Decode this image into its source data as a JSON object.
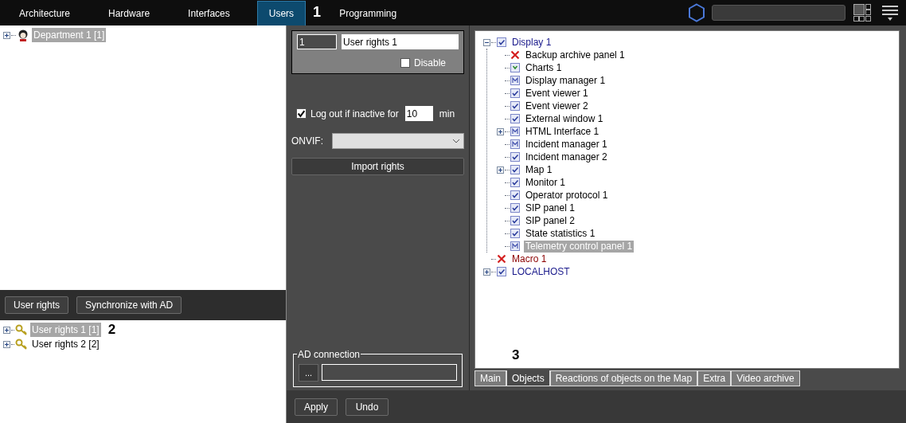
{
  "top_tabs": [
    {
      "label": "Architecture",
      "selected": false
    },
    {
      "label": "Hardware",
      "selected": false
    },
    {
      "label": "Interfaces",
      "selected": false
    },
    {
      "label": "Users",
      "selected": true
    },
    {
      "label": "Programming",
      "selected": false
    }
  ],
  "callouts": [
    "1",
    "2",
    "3"
  ],
  "departments": [
    {
      "label": "Department 1 [1]",
      "selected": true,
      "has_children": true,
      "expanded": false
    }
  ],
  "left_buttons": [
    "User rights",
    "Synchronize with AD"
  ],
  "rights": [
    {
      "label": "User rights 1 [1]",
      "selected": true,
      "has_children": true,
      "expanded": false
    },
    {
      "label": "User rights 2 [2]",
      "selected": false,
      "has_children": true,
      "expanded": false
    }
  ],
  "rights_header": {
    "number": "1",
    "name": "User rights 1",
    "disable_label": "Disable",
    "disable_checked": false
  },
  "logout": {
    "label": "Log out if inactive for",
    "checked": true,
    "value": "10",
    "unit": "min"
  },
  "onvif": {
    "label": "ONVIF:"
  },
  "import_button": "Import rights",
  "ad_connection": {
    "title": "AD connection",
    "button": "..."
  },
  "objects": [
    {
      "label": "Display 1",
      "kind": "check",
      "has_children": true,
      "expanded": true,
      "selected": false,
      "color": "#1a1a8c",
      "children": [
        {
          "label": "Backup archive panel 1",
          "kind": "cross",
          "has_children": false,
          "selected": false,
          "color": "#000000"
        },
        {
          "label": "Charts 1",
          "kind": "check_green",
          "has_children": false,
          "selected": false,
          "color": "#000000"
        },
        {
          "label": "Display manager 1",
          "kind": "module",
          "has_children": false,
          "selected": false,
          "color": "#000000"
        },
        {
          "label": "Event viewer 1",
          "kind": "check",
          "has_children": false,
          "selected": false,
          "color": "#000000"
        },
        {
          "label": "Event viewer 2",
          "kind": "check",
          "has_children": false,
          "selected": false,
          "color": "#000000"
        },
        {
          "label": "External window 1",
          "kind": "check",
          "has_children": false,
          "selected": false,
          "color": "#000000"
        },
        {
          "label": "HTML Interface 1",
          "kind": "module",
          "has_children": true,
          "expanded": false,
          "selected": false,
          "color": "#000000"
        },
        {
          "label": "Incident manager 1",
          "kind": "module",
          "has_children": false,
          "selected": false,
          "color": "#000000"
        },
        {
          "label": "Incident manager 2",
          "kind": "check",
          "has_children": false,
          "selected": false,
          "color": "#000000"
        },
        {
          "label": "Map 1",
          "kind": "check",
          "has_children": true,
          "expanded": false,
          "selected": false,
          "color": "#000000"
        },
        {
          "label": "Monitor 1",
          "kind": "check",
          "has_children": false,
          "selected": false,
          "color": "#000000"
        },
        {
          "label": "Operator protocol 1",
          "kind": "check",
          "has_children": false,
          "selected": false,
          "color": "#000000"
        },
        {
          "label": "SIP panel 1",
          "kind": "check",
          "has_children": false,
          "selected": false,
          "color": "#000000"
        },
        {
          "label": "SIP panel 2",
          "kind": "check",
          "has_children": false,
          "selected": false,
          "color": "#000000"
        },
        {
          "label": "State statistics 1",
          "kind": "check",
          "has_children": false,
          "selected": false,
          "color": "#000000"
        },
        {
          "label": "Telemetry control panel 1",
          "kind": "module",
          "has_children": false,
          "selected": true
        }
      ]
    },
    {
      "label": "Macro 1",
      "kind": "cross",
      "has_children": false,
      "selected": false,
      "color": "#8b0000"
    },
    {
      "label": "LOCALHOST",
      "kind": "check",
      "has_children": true,
      "expanded": false,
      "selected": false,
      "color": "#1a1a8c"
    }
  ],
  "bottom_tabs": [
    {
      "label": "Main",
      "selected": false
    },
    {
      "label": "Objects",
      "selected": true
    },
    {
      "label": "Reactions of objects on the Map",
      "selected": false
    },
    {
      "label": "Extra",
      "selected": false
    },
    {
      "label": "Video archive",
      "selected": false
    }
  ],
  "actions": [
    "Apply",
    "Undo"
  ]
}
